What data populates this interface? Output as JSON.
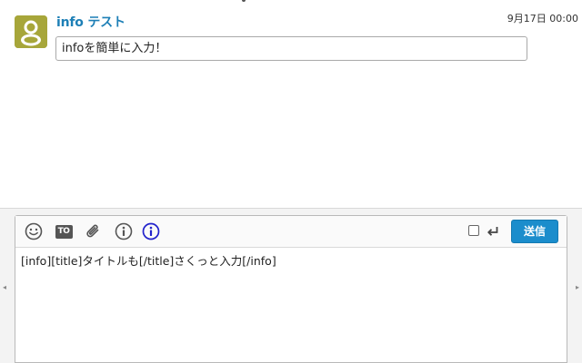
{
  "message": {
    "sender": "info テスト",
    "timestamp": "9月17日 00:00",
    "info_content": "infoを簡単に入力！",
    "avatar_icon": "user-avatar-icon",
    "avatar_color": "#a7a63a",
    "sender_color": "#1d7fb6"
  },
  "composer": {
    "toolbar": {
      "icons": [
        "emoji-icon",
        "to-icon",
        "attachment-icon",
        "info-icon",
        "info-active-icon"
      ],
      "to_label": "TO",
      "enter_icon": "enter-key-icon",
      "send_label": "送信",
      "send_color": "#1b8dcc",
      "active_icon_color": "#2222cc"
    },
    "input_text": "[info][title]タイトルも[/title]さくっと入力[/info]"
  },
  "scroll": {
    "left_arrow": "◂",
    "right_arrow": "▸"
  }
}
